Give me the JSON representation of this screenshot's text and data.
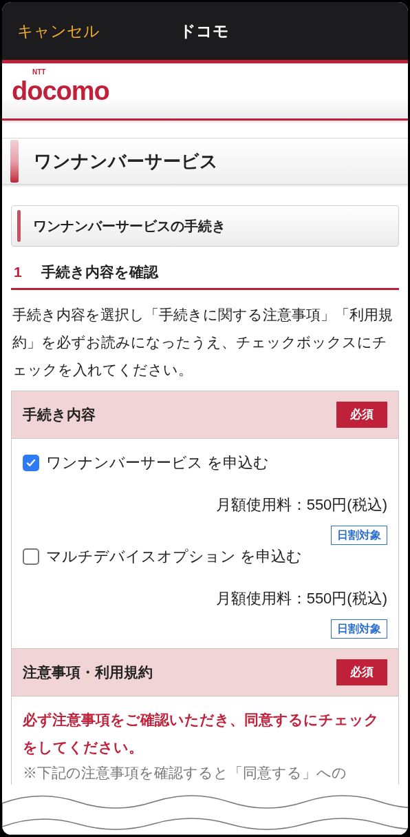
{
  "nav_bar": {
    "cancel": "キャンセル",
    "title": "ドコモ"
  },
  "logo": {
    "small": "NTT",
    "main": "docomo"
  },
  "page_title": "ワンナンバーサービス",
  "section_title": "ワンナンバーサービスの手続き",
  "step": {
    "number": "1",
    "title": "手続き内容を確認"
  },
  "intro": "手続き内容を選択し「手続きに関する注意事項」「利用規約」を必ずお読みになったうえ、チェックボックスにチェックを入れてください。",
  "procedure": {
    "heading": "手続き内容",
    "badge": "必須",
    "options": [
      {
        "label": "ワンナンバーサービス を申込む",
        "checked": true,
        "price": "月額使用料：550円(税込)",
        "tag": "日割対象"
      },
      {
        "label": "マルチデバイスオプション を申込む",
        "checked": false,
        "price": "月額使用料：550円(税込)",
        "tag": "日割対象"
      }
    ]
  },
  "terms": {
    "heading": "注意事項・利用規約",
    "badge": "必須",
    "warning": "必ず注意事項をご確認いただき、同意するにチェックをしてください。",
    "note": "※下記の注意事項を確認すると「同意する」への"
  }
}
